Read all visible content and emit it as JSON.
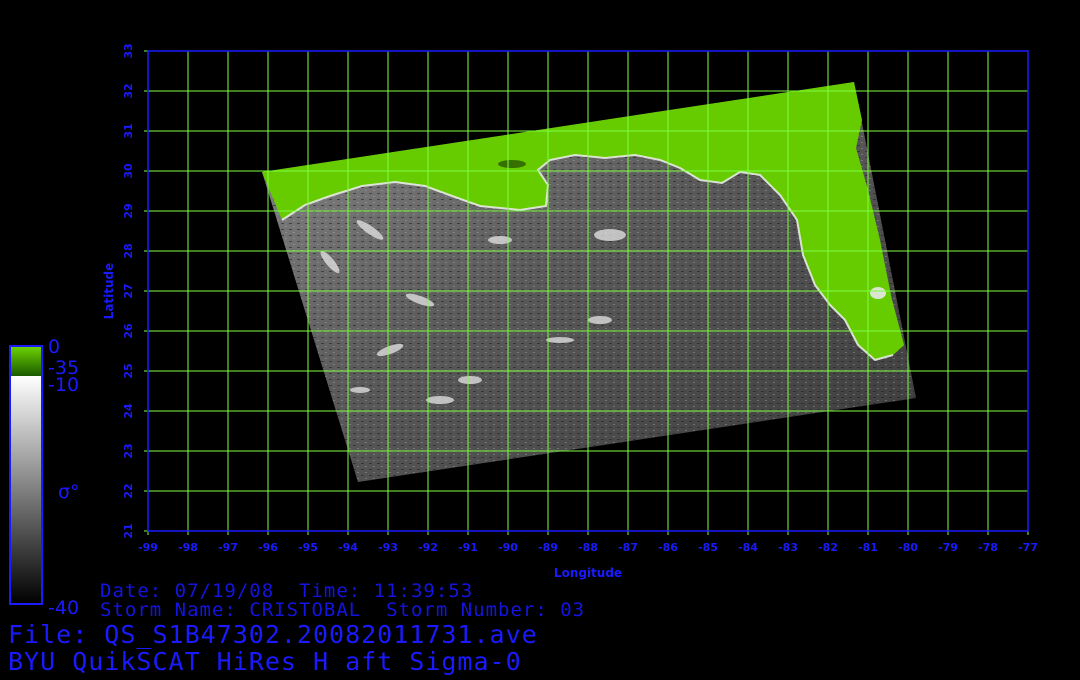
{
  "map": {
    "longitude_ticks": [
      "-99",
      "-98",
      "-97",
      "-96",
      "-95",
      "-94",
      "-93",
      "-92",
      "-91",
      "-90",
      "-89",
      "-88",
      "-87",
      "-86",
      "-85",
      "-84",
      "-83",
      "-82",
      "-81",
      "-80",
      "-79",
      "-78",
      "-77"
    ],
    "latitude_ticks": [
      "21",
      "22",
      "23",
      "24",
      "25",
      "26",
      "27",
      "28",
      "29",
      "30",
      "31",
      "32",
      "33"
    ],
    "lon_range": [
      -99,
      -77
    ],
    "lat_range": [
      21,
      33
    ],
    "x_label": "Longitude",
    "y_label": "Latitude",
    "grid_color": "#7fff3f",
    "frame_color": "#1a1aff",
    "land_color": "#66cc00"
  },
  "colorbar": {
    "top_value": "0",
    "split_value": "-35",
    "upper_gray_value": "-10",
    "bottom_value": "-40",
    "symbol": "σ°"
  },
  "info": {
    "date_line": "Date: 07/19/08  Time: 11:39:53",
    "storm_line": "Storm Name: CRISTOBAL  Storm Number: 03"
  },
  "footer": {
    "file_line": "File: QS_S1B47302.20082011731.ave",
    "product_line": "BYU QuikSCAT HiRes H aft Sigma-0"
  }
}
